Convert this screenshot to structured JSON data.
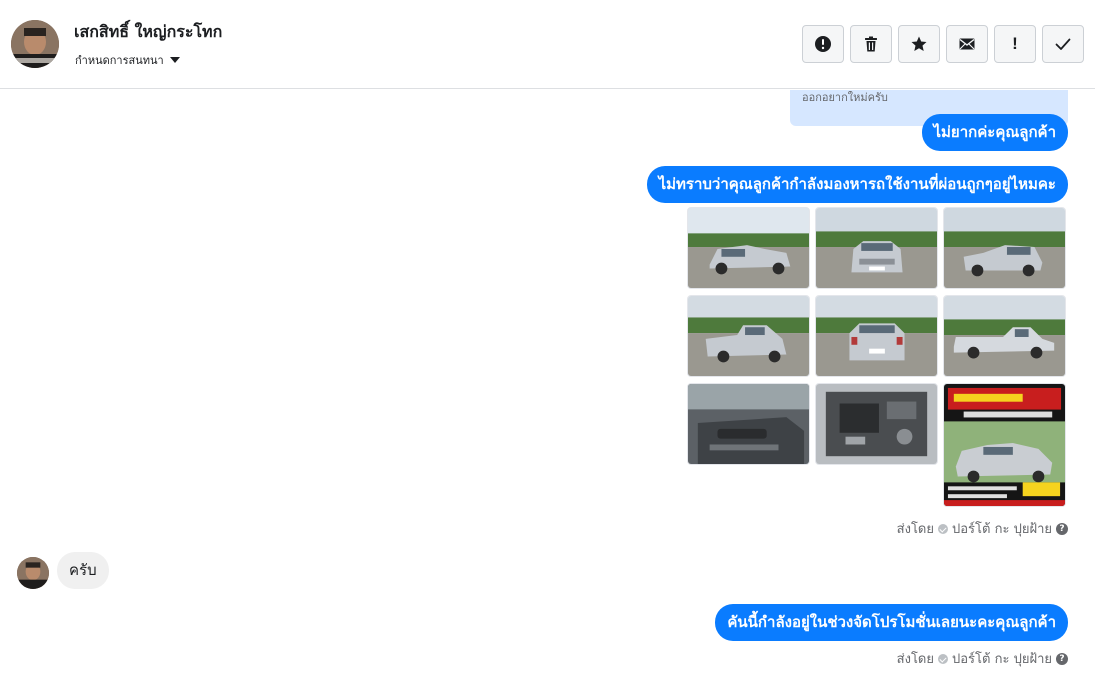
{
  "header": {
    "contact_name": "เสกสิทธิ์ ใหญ่กระโทก",
    "assign_label": "กำหนดการสนทนา",
    "actions": [
      {
        "name": "mark-spam-button",
        "icon": "alert-circle-icon"
      },
      {
        "name": "delete-button",
        "icon": "trash-icon"
      },
      {
        "name": "star-button",
        "icon": "star-icon"
      },
      {
        "name": "mark-unread-button",
        "icon": "envelope-icon"
      },
      {
        "name": "follow-up-button",
        "icon": "exclamation-icon",
        "text": "!"
      },
      {
        "name": "mark-done-button",
        "icon": "check-icon"
      }
    ]
  },
  "thread": {
    "quoted_reply": "ออกอยากใหม่ครับ",
    "messages": [
      {
        "id": "m1",
        "direction": "outgoing",
        "text": "ไม่ยากค่ะคุณลูกค้า"
      },
      {
        "id": "m2",
        "direction": "outgoing",
        "text": "ไม่ทราบว่าคุณลูกค้ากำลังมองหารถใช้งานที่ผ่อนถูกๆอยู่ไหมคะ"
      },
      {
        "id": "m3",
        "direction": "incoming",
        "text": "ครับ"
      },
      {
        "id": "m4",
        "direction": "outgoing",
        "text": "คันนี้กำลังอยู่ในช่วงจัดโปรโมชั่นเลยนะคะคุณลูกค้า"
      }
    ],
    "photos": [
      {
        "name": "photo-front-left"
      },
      {
        "name": "photo-front"
      },
      {
        "name": "photo-front-right"
      },
      {
        "name": "photo-rear-left"
      },
      {
        "name": "photo-rear"
      },
      {
        "name": "photo-side"
      },
      {
        "name": "photo-door-interior"
      },
      {
        "name": "photo-engine"
      },
      {
        "name": "photo-promo-poster"
      }
    ],
    "sent_by": {
      "prefix": "ส่งโดย",
      "agent": "ปอร์โต้ กะ ปุยฝ้าย"
    }
  },
  "colors": {
    "outgoing_bubble": "#0a7cff",
    "incoming_bubble": "#f0f0f0",
    "quote_bg": "#d6e7ff"
  }
}
